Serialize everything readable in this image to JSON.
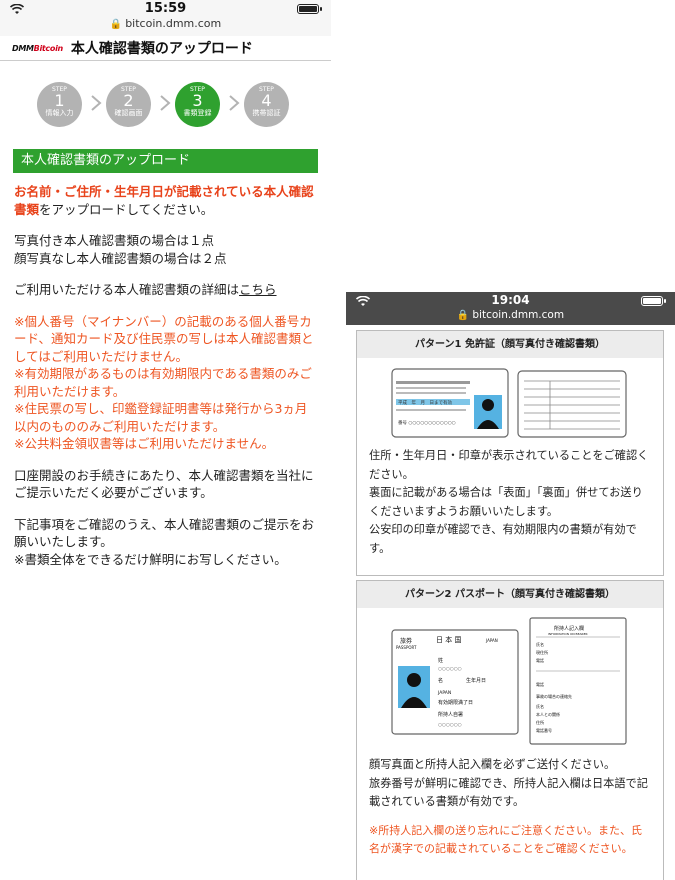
{
  "left": {
    "status": {
      "time": "15:59",
      "url": "bitcoin.dmm.com"
    },
    "app": {
      "logo_dmm": "DMM",
      "logo_bitcoin": "Bitcoin",
      "title": "本人確認書類のアップロード"
    },
    "steps": [
      {
        "step": "STEP",
        "num": "1",
        "label": "情報入力"
      },
      {
        "step": "STEP",
        "num": "2",
        "label": "確認画面"
      },
      {
        "step": "STEP",
        "num": "3",
        "label": "書類登録"
      },
      {
        "step": "STEP",
        "num": "4",
        "label": "携帯認証"
      }
    ],
    "section_title": "本人確認書類のアップロード",
    "intro_red": "お名前・ご住所・生年月日が記載されている本人確認書類",
    "intro_rest": "をアップロードしてください。",
    "photo_line1": "写真付き本人確認書類の場合は１点",
    "photo_line2": "顔写真なし本人確認書類の場合は２点",
    "details_text": "ご利用いただける本人確認書類の詳細は",
    "details_link": "こちら",
    "notes": [
      "※個人番号（マイナンバー）の記載のある個人番号カード、通知カード及び住民票の写しは本人確認書類としてはご利用いただけません。",
      "※有効期限があるものは有効期限内である書類のみご利用いただけます。",
      "※住民票の写し、印鑑登録証明書等は発行から3ヵ月以内のもののみご利用いただけます。",
      "※公共料金領収書等はご利用いただけません。"
    ],
    "para_open": "口座開設のお手続きにあたり、本人確認書類を当社にご提示いただく必要がございます。",
    "para_confirm": "下記事項をご確認のうえ、本人確認書類のご提示をお願いいたします。",
    "para_clear": "※書類全体をできるだけ鮮明にお写しください。"
  },
  "right": {
    "status": {
      "time": "19:04",
      "url": "bitcoin.dmm.com"
    },
    "pattern1": {
      "title": "パターン1 免許証（顔写真付き確認書類）",
      "license_text": [
        "平成　年　月　日まで有効",
        "番号 ○○○○○○○○○○○○"
      ],
      "body": [
        "住所・生年月日・印章が表示されていることをご確認ください。",
        "裏面に記載がある場合は「表面」「裏面」併せてお送りくださいますようお願いいたします。",
        "公安印の印章が確認でき、有効期限内の書類が有効です。"
      ]
    },
    "pattern2": {
      "title": "パターン2 パスポート（顔写真付き確認書類）",
      "passport": {
        "tag": "旅券",
        "tag_en": "PASSPORT",
        "country": "日 本 国",
        "country_en": "JAPAN",
        "surname": "姓",
        "name": "名",
        "birth": "生年月日",
        "country_row": "JAPAN",
        "expiry": "有効期限満了日",
        "owner": "所持人自署",
        "placeholder": "○○○○○○"
      },
      "owner_page": {
        "title": "所持人記入欄",
        "title_en": "INFORMATION ON BEARER",
        "rows": [
          "氏名",
          "現住所",
          "電話",
          "電話",
          "事故の場合の連絡先",
          "氏名",
          "本人との関係",
          "住所",
          "電話番号"
        ]
      },
      "body": [
        "顔写真面と所持人記入欄を必ずご送付ください。",
        "旅券番号が鮮明に確認でき、所持人記入欄は日本語で記載されている書類が有効です。"
      ],
      "note": "※所持人記入欄の送り忘れにご注意ください。また、氏名が漢字での記載されていることをご確認ください。"
    }
  },
  "colors": {
    "green": "#2fa12f",
    "red": "#e8431b",
    "step_grey": "#b3b3b3"
  }
}
